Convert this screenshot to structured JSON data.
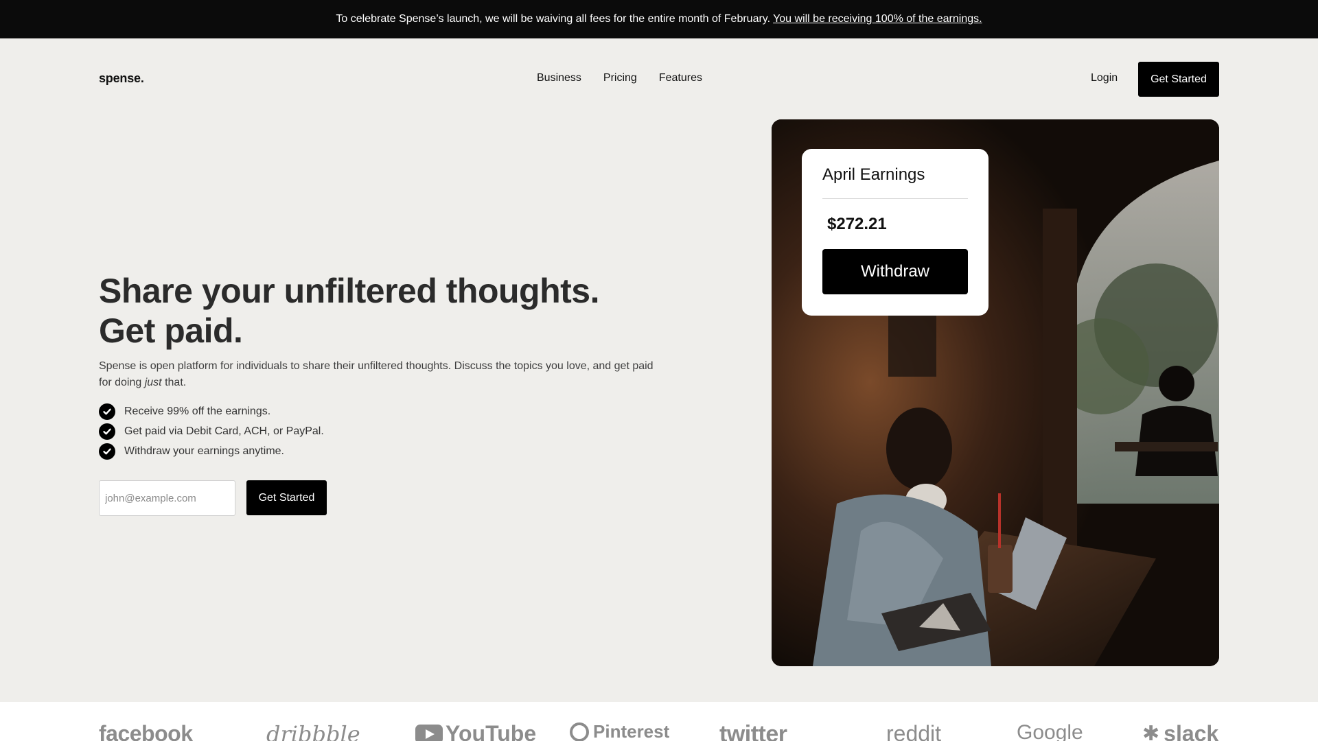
{
  "announcement": {
    "text": "To celebrate Spense’s launch, we will be waiving all fees for the entire month of February.",
    "link": "You will be receiving 100% of the earnings."
  },
  "nav": {
    "logo": "spense.",
    "links": [
      "Business",
      "Pricing",
      "Features"
    ],
    "login": "Login",
    "cta": "Get Started"
  },
  "hero": {
    "title": "Share your unfiltered thoughts. Get paid.",
    "description_before": "Spense is open platform for individuals to share their unfiltered thoughts. Discuss the topics you love, and get paid for doing ",
    "description_emphasis": "just",
    "description_after": " that.",
    "benefits": [
      "Receive 99% off the earnings.",
      "Get paid via Debit Card, ACH, or PayPal.",
      "Withdraw your earnings anytime."
    ],
    "email_placeholder": "john@example.com",
    "cta": "Get Started"
  },
  "earnings_card": {
    "title": "April Earnings",
    "amount": "$272.21",
    "button": "Withdraw"
  },
  "partners": [
    "facebook",
    "dribbble",
    "YouTube",
    "Pinterest",
    "twitter",
    "reddit",
    "Google",
    "slack"
  ],
  "colors": {
    "page_bg": "#efeeeb",
    "announcement_bg": "#0b0b0b",
    "button_bg": "#000000",
    "partner_logo": "#8c8c8c"
  }
}
